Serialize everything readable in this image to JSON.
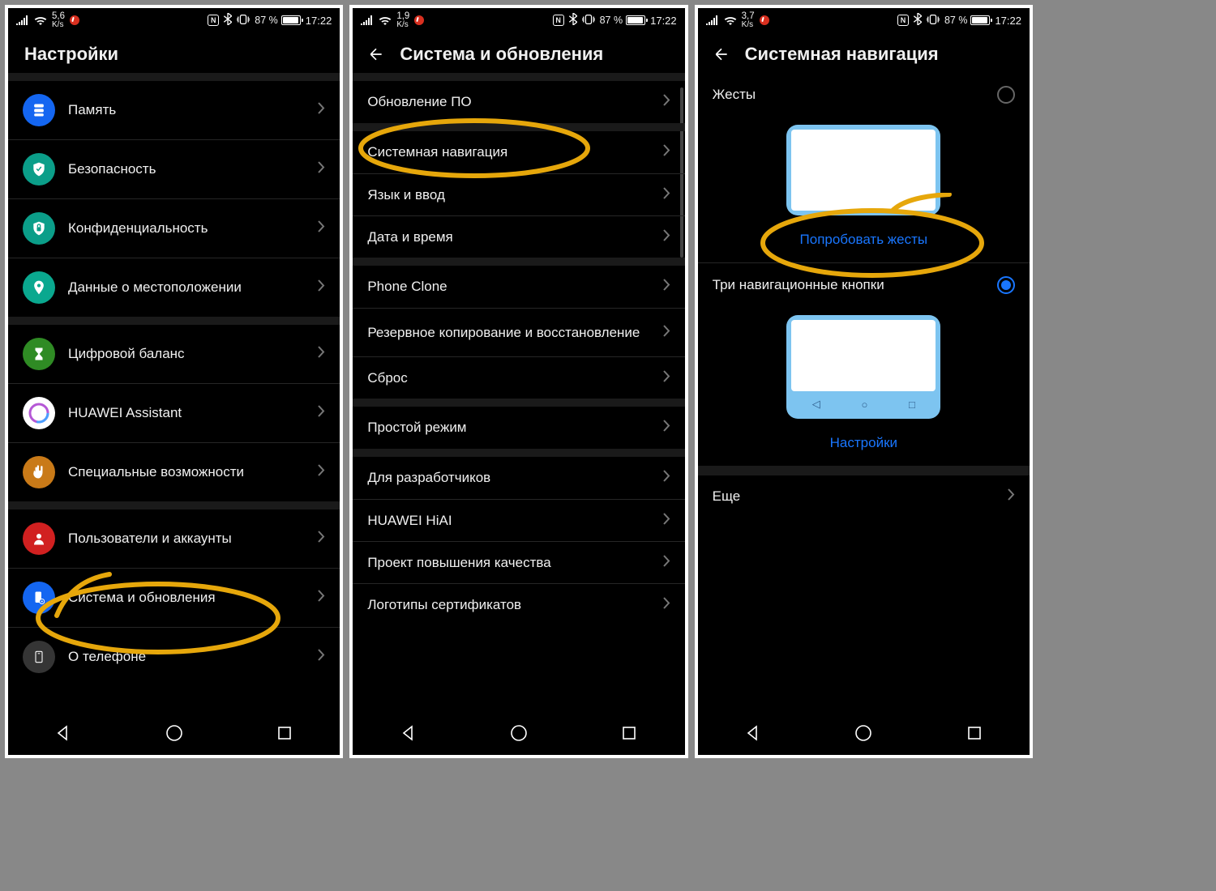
{
  "status": {
    "speeds": [
      "5,6",
      "1,9",
      "3,7"
    ],
    "speed_unit": "K/s",
    "battery_pct": "87 %",
    "time": "17:22",
    "nfc": "N"
  },
  "screen1": {
    "title": "Настройки",
    "items": [
      {
        "label": "Память",
        "icon": "storage",
        "color": "c-blue"
      },
      {
        "label": "Безопасность",
        "icon": "shield-check",
        "color": "c-teal"
      },
      {
        "label": "Конфиденциальность",
        "icon": "shield-lock",
        "color": "c-teal"
      },
      {
        "label": "Данные о местоположении",
        "icon": "pin",
        "color": "c-teal2"
      }
    ],
    "items2": [
      {
        "label": "Цифровой баланс",
        "icon": "hourglass",
        "color": "c-green"
      },
      {
        "label": "HUAWEI Assistant",
        "icon": "assistant",
        "color": "c-white"
      },
      {
        "label": "Специальные возможности",
        "icon": "hand",
        "color": "c-orange"
      }
    ],
    "items3": [
      {
        "label": "Пользователи и аккаунты",
        "icon": "user",
        "color": "c-red"
      },
      {
        "label": "Система и обновления",
        "icon": "phone-gear",
        "color": "c-lblue"
      },
      {
        "label": "О телефоне",
        "icon": "phone-info",
        "color": "c-grey"
      }
    ]
  },
  "screen2": {
    "title": "Система и обновления",
    "g1": [
      {
        "label": "Обновление ПО"
      }
    ],
    "g2": [
      {
        "label": "Системная навигация"
      },
      {
        "label": "Язык и ввод"
      },
      {
        "label": "Дата и время"
      }
    ],
    "g3": [
      {
        "label": "Phone Clone"
      },
      {
        "label": "Резервное копирование и восстановление"
      },
      {
        "label": "Сброс"
      }
    ],
    "g4": [
      {
        "label": "Простой режим"
      }
    ],
    "g5": [
      {
        "label": "Для разработчиков"
      },
      {
        "label": "HUAWEI HiAI"
      },
      {
        "label": "Проект повышения качества"
      },
      {
        "label": "Логотипы сертификатов"
      }
    ]
  },
  "screen3": {
    "title": "Системная навигация",
    "opt_gestures": "Жесты",
    "try_gestures": "Попробовать жесты",
    "opt_three": "Три навигационные кнопки",
    "settings_link": "Настройки",
    "more": "Еще"
  }
}
